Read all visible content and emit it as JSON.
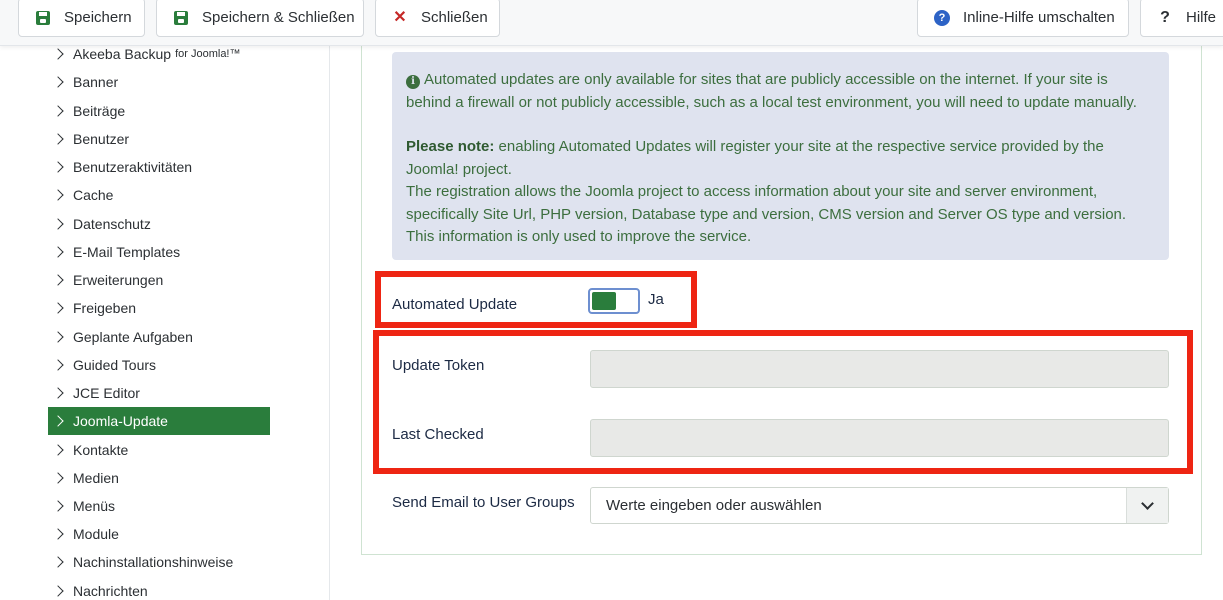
{
  "toolbar": {
    "save_label": "Speichern",
    "save_close_label": "Speichern & Schließen",
    "close_label": "Schließen",
    "help_toggle_label": "Inline-Hilfe umschalten",
    "help_label": "Hilfe"
  },
  "sidebar": {
    "items": [
      {
        "label": "Akeeba Backup",
        "suffix": "for Joomla!™"
      },
      {
        "label": "Banner"
      },
      {
        "label": "Beiträge"
      },
      {
        "label": "Benutzer"
      },
      {
        "label": "Benutzeraktivitäten"
      },
      {
        "label": "Cache"
      },
      {
        "label": "Datenschutz"
      },
      {
        "label": "E-Mail Templates"
      },
      {
        "label": "Erweiterungen"
      },
      {
        "label": "Freigeben"
      },
      {
        "label": "Geplante Aufgaben"
      },
      {
        "label": "Guided Tours"
      },
      {
        "label": "JCE Editor"
      },
      {
        "label": "Joomla-Update",
        "active": true
      },
      {
        "label": "Kontakte"
      },
      {
        "label": "Medien"
      },
      {
        "label": "Menüs"
      },
      {
        "label": "Module"
      },
      {
        "label": "Nachinstallationshinweise"
      },
      {
        "label": "Nachrichten"
      }
    ]
  },
  "alert": {
    "line1": "Automated updates are only available for sites that are publicly accessible on the internet. If your site is behind a firewall or not publicly accessible, such as a local test environment, you will need to update manually.",
    "note_label": "Please note:",
    "note_text": " enabling Automated Updates will register your site at the respective service provided by the Joomla! project.",
    "line3": "The registration allows the Joomla project to access information about your site and server environment, specifically Site Url, PHP version, Database type and version, CMS version and Server OS type and version.",
    "line4": "This information is only used to improve the service."
  },
  "form": {
    "automated_update_label": "Automated Update",
    "automated_update_value": "Ja",
    "update_token_label": "Update Token",
    "update_token_value": "",
    "last_checked_label": "Last Checked",
    "last_checked_value": "",
    "send_email_label": "Send Email to User Groups",
    "send_email_placeholder": "Werte eingeben oder auswählen"
  },
  "colors": {
    "accent_green": "#2a7d3c",
    "highlight_red": "#ee2513",
    "alert_bg": "#dfe3ef",
    "alert_text": "#3c6e3e"
  }
}
